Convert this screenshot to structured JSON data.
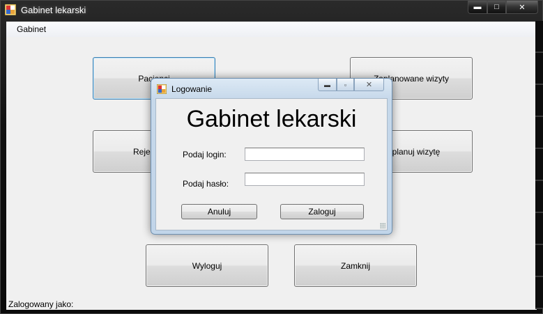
{
  "window": {
    "title": "Gabinet lekarski",
    "caption_min": "▬",
    "caption_max": "□",
    "caption_close": "✕"
  },
  "menu": {
    "items": [
      "Gabinet"
    ]
  },
  "buttons": {
    "pacjenci": "Pacjenci",
    "zaplanowane_wizyty": "Zaplanowane wizyty",
    "rejestracja": "Rejestracja",
    "zaplanuj_wizyte": "Zaplanuj wizytę",
    "wyloguj": "Wyloguj",
    "zamknij": "Zamknij"
  },
  "status": {
    "label": "Zalogowany jako:"
  },
  "dialog": {
    "title": "Logowanie",
    "heading": "Gabinet lekarski",
    "login_label": "Podaj login:",
    "login_value": "",
    "password_label": "Podaj hasło:",
    "password_value": "",
    "cancel_label": "Anuluj",
    "submit_label": "Zaloguj",
    "caption_min": "▬",
    "caption_max": "▫",
    "caption_close": "✕"
  },
  "colors": {
    "focus_border": "#3c7fb1",
    "dialog_frame": "#c1d5e9",
    "client_bg": "#f0f0f0"
  }
}
